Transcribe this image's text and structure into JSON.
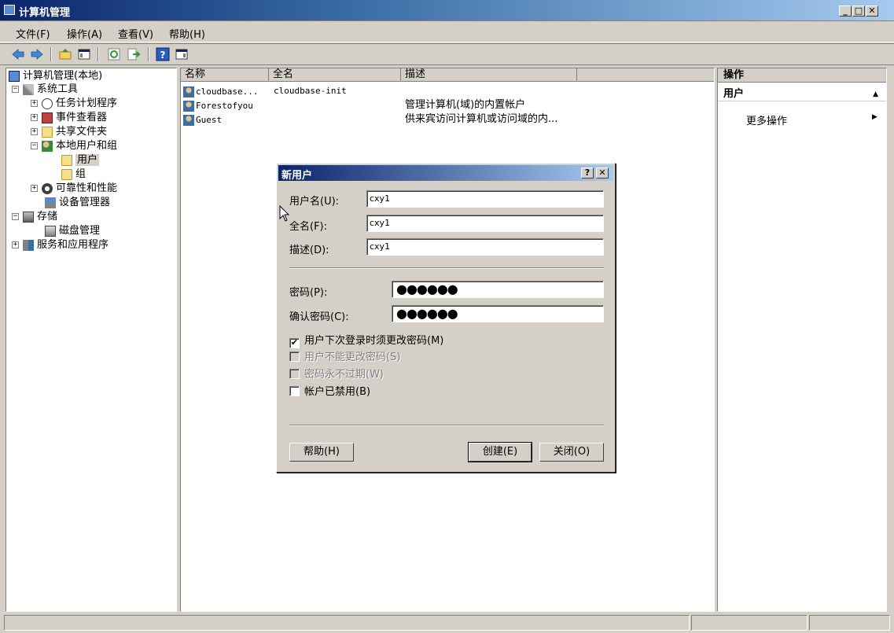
{
  "window": {
    "title": "计算机管理",
    "minimize": "_",
    "maximize": "□",
    "close": "✕"
  },
  "menu": [
    "文件(F)",
    "操作(A)",
    "查看(V)",
    "帮助(H)"
  ],
  "tree": {
    "root": "计算机管理(本地)",
    "items": [
      {
        "label": "系统工具",
        "expander": "−"
      },
      {
        "label": "任务计划程序",
        "expander": "+"
      },
      {
        "label": "事件查看器",
        "expander": "+"
      },
      {
        "label": "共享文件夹",
        "expander": "+"
      },
      {
        "label": "本地用户和组",
        "expander": "−"
      },
      {
        "label": "用户",
        "expander": ""
      },
      {
        "label": "组",
        "expander": ""
      },
      {
        "label": "可靠性和性能",
        "expander": "+"
      },
      {
        "label": "设备管理器",
        "expander": ""
      },
      {
        "label": "存储",
        "expander": "−"
      },
      {
        "label": "磁盘管理",
        "expander": ""
      },
      {
        "label": "服务和应用程序",
        "expander": "+"
      }
    ]
  },
  "list": {
    "columns": [
      "名称",
      "全名",
      "描述"
    ],
    "rows": [
      {
        "name": "cloudbase...",
        "fullname": "cloudbase-init",
        "desc": ""
      },
      {
        "name": "Forestofyou",
        "fullname": "",
        "desc": "管理计算机(域)的内置帐户"
      },
      {
        "name": "Guest",
        "fullname": "",
        "desc": "供来宾访问计算机或访问域的内..."
      }
    ]
  },
  "actions": {
    "header": "操作",
    "section": "用户",
    "section_arrow": "▲",
    "more": "更多操作",
    "more_arrow": "▶"
  },
  "dialog": {
    "title": "新用户",
    "help_glyph": "?",
    "close_glyph": "✕",
    "username_label": "用户名(U):",
    "username": "cxy1",
    "fullname_label": "全名(F):",
    "fullname": "cxy1",
    "desc_label": "描述(D):",
    "desc": "cxy1",
    "password_label": "密码(P):",
    "password": "●●●●●●",
    "confirm_label": "确认密码(C):",
    "confirm": "●●●●●●",
    "checkboxes": [
      {
        "label": "用户下次登录时须更改密码(M)",
        "checked": "✔",
        "disabled": false
      },
      {
        "label": "用户不能更改密码(S)",
        "checked": "",
        "disabled": true
      },
      {
        "label": "密码永不过期(W)",
        "checked": "",
        "disabled": true
      },
      {
        "label": "帐户已禁用(B)",
        "checked": "",
        "disabled": false
      }
    ],
    "help_button": "帮助(H)",
    "create_button": "创建(E)",
    "close_button": "关闭(O)"
  },
  "colors": {
    "titlebar": "#0a246a",
    "face": "#d4d0c8"
  }
}
